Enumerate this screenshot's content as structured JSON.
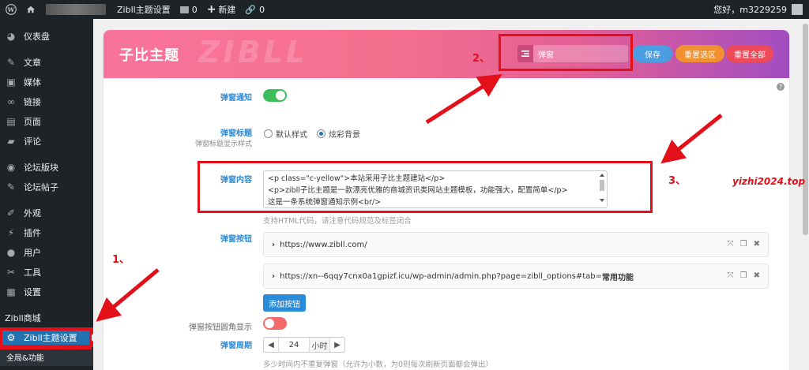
{
  "adminbar": {
    "site_title": "Zibll主题设置",
    "comments_count": "0",
    "new_label": "新建",
    "links_count": "0",
    "greeting": "您好，m3229259"
  },
  "sidebar": {
    "items": [
      {
        "label": "仪表盘",
        "icon": "dashboard-icon",
        "glyph": "◕"
      },
      {
        "label": "文章",
        "icon": "pin-icon",
        "glyph": "✎"
      },
      {
        "label": "媒体",
        "icon": "media-icon",
        "glyph": "▣"
      },
      {
        "label": "链接",
        "icon": "link-icon",
        "glyph": "∞"
      },
      {
        "label": "页面",
        "icon": "page-icon",
        "glyph": "▤"
      },
      {
        "label": "评论",
        "icon": "comment-icon",
        "glyph": "▰"
      },
      {
        "label": "论坛版块",
        "icon": "forum-icon",
        "glyph": "◉"
      },
      {
        "label": "论坛帖子",
        "icon": "post-icon",
        "glyph": "✎"
      },
      {
        "label": "外观",
        "icon": "brush-icon",
        "glyph": "✐"
      },
      {
        "label": "插件",
        "icon": "plugin-icon",
        "glyph": "⚡"
      },
      {
        "label": "用户",
        "icon": "user-icon",
        "glyph": "●"
      },
      {
        "label": "工具",
        "icon": "wrench-icon",
        "glyph": "✂"
      },
      {
        "label": "设置",
        "icon": "settings-icon",
        "glyph": "▦"
      },
      {
        "label": "Zibll商城",
        "icon": "shop-icon",
        "glyph": ""
      },
      {
        "label": "Zibll主题设置",
        "icon": "gear-icon",
        "glyph": "⚙"
      }
    ],
    "submenu_label": "全局&功能"
  },
  "banner": {
    "title": "子比主题",
    "watermark": "ZIBLL",
    "search_value": "弹窗",
    "save": "保存",
    "reset_section": "重置选区",
    "reset_all": "重置全部"
  },
  "form": {
    "popup_notice_label": "弹窗通知",
    "popup_title_label": "弹窗标题",
    "popup_title_sub": "弹窗标题显示样式",
    "radio_default": "默认样式",
    "radio_colorful": "炫彩背景",
    "popup_content_label": "弹窗内容",
    "code_lines": [
      "<p class=\"c-yellow\">本站采用子比主题建站</p>",
      "<p>zibll子比主题是一款漂亮优雅的商城资讯类网站主题模板，功能强大，配置简单</p>",
      "这是一条系统弹窗通知示例<br/>"
    ],
    "content_hint": "支持HTML代码，请注意代码规范及标签闭合",
    "popup_buttons_label": "弹窗按钮",
    "button_items": [
      {
        "text": "https://www.zibll.com/",
        "strong": ""
      },
      {
        "text": "https://xn--6qqy7cnx0a1gpizf.icu/wp-admin/admin.php?page=zibll_options#tab=",
        "strong": "常用功能"
      }
    ],
    "add_button": "添加按钮",
    "round_label": "弹窗按钮圆角显示",
    "cycle_label": "弹窗周期",
    "cycle_value": "24",
    "cycle_unit": "小时",
    "cycle_hint": "多少时间内不重复弹窗（允许为小数，为0则每次刷新页面都会弹出）"
  },
  "annotations": {
    "n1": "1、",
    "n2": "2、",
    "n3": "3、",
    "watermark": "yizhi2024.top",
    "color": "#e3101a"
  },
  "colors": {
    "adminbar": "#1d2327",
    "active_menu": "#2271b1",
    "toggle_on": "#3ebd5b",
    "toggle_off": "#f26a6a",
    "label_blue": "#2a8bd8"
  }
}
